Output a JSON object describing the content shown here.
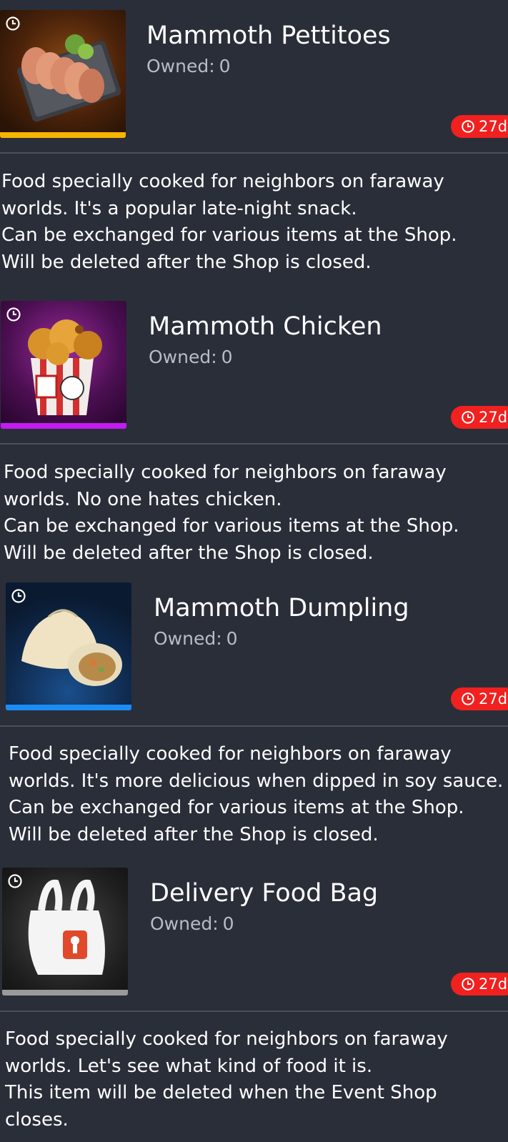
{
  "items": [
    {
      "title": "Mammoth Pettitoes",
      "owned_label": "Owned:",
      "owned_count": "0",
      "timer": "27d",
      "rarity_color": "#f7b400",
      "desc_lines": [
        "Food specially cooked for neighbors on faraway",
        "worlds. It's a popular late-night snack.",
        "Can be exchanged for various items at the Shop.",
        "Will be deleted after the Shop is closed."
      ]
    },
    {
      "title": "Mammoth Chicken",
      "owned_label": "Owned:",
      "owned_count": "0",
      "timer": "27d",
      "rarity_color": "#c21cf0",
      "desc_lines": [
        "Food specially cooked for neighbors on faraway",
        "worlds. No one hates chicken.",
        "Can be exchanged for various items at the Shop.",
        "Will be deleted after the Shop is closed."
      ]
    },
    {
      "title": "Mammoth Dumpling",
      "owned_label": "Owned:",
      "owned_count": "0",
      "timer": "27d",
      "rarity_color": "#1c8cf5",
      "desc_lines": [
        "Food specially cooked for neighbors on faraway",
        "worlds. It's more delicious when dipped in soy sauce.",
        "Can be exchanged for various items at the Shop.",
        "Will be deleted after the Shop is closed."
      ]
    },
    {
      "title": "Delivery Food Bag",
      "owned_label": "Owned:",
      "owned_count": "0",
      "timer": "27d",
      "rarity_color": "#9a9a9a",
      "desc_lines": [
        "Food specially cooked for neighbors on faraway",
        "worlds. Let's see what kind of food it is.",
        "This item will be deleted when the Event Shop",
        "closes."
      ]
    }
  ],
  "icons": {
    "clock": "clock-icon",
    "timer": "timer-clock-icon"
  },
  "colors": {
    "background": "#2a2e39",
    "timer_badge": "#f0211f",
    "owned_text": "#b8bcc6"
  }
}
